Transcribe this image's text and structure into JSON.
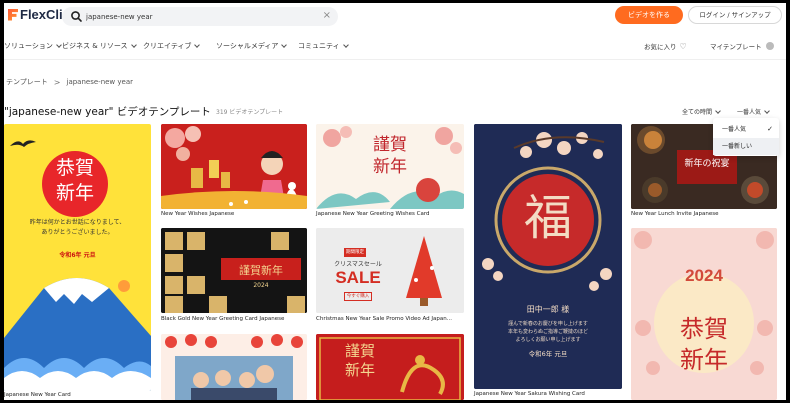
{
  "header": {
    "logo": "FlexClip",
    "search_value": "japanese-new year",
    "clear": "×",
    "create_btn": "ビデオを作る",
    "login_btn": "ログイン / サインアップ"
  },
  "nav": {
    "items": [
      {
        "label": "ソリューション"
      },
      {
        "label": "ビジネス & リソース"
      },
      {
        "label": "クリエイティブ"
      },
      {
        "label": "ソーシャルメディア"
      },
      {
        "label": "コミュニティ"
      }
    ],
    "favorites": "お気に入り",
    "my_templates": "マイテンプレート"
  },
  "breadcrumb": {
    "root": "テンプレート",
    "sep": ">",
    "current": "japanese-new year"
  },
  "title": {
    "text": "\"japanese-new year\" ビデオテンプレート",
    "count": "319 ビデオテンプレート"
  },
  "filters": {
    "time": "全ての時間",
    "sort": "一番人気",
    "options": [
      {
        "label": "一番人気",
        "selected": true
      },
      {
        "label": "一番新しい",
        "selected": false
      }
    ],
    "check": "✓"
  },
  "cards": {
    "c1": {
      "caption": "Japanese New Year Card",
      "kanji": "恭賀\n新年",
      "greeting": "昨年は何かとお世話になりまして、\nありがとうございました。",
      "date": "令和6年 元旦"
    },
    "c2": {
      "caption": "New Year Wishes Japanese"
    },
    "c3": {
      "caption": "Japanese New Year Greeting Wishes Card",
      "kanji": "謹賀\n新年"
    },
    "c4": {
      "caption": "Japanese New Year Sakura Wishing Card",
      "kanji": "福",
      "name": "田中一郎 様",
      "line1": "謹んで新春のお慶びを申し上げます",
      "line2": "本年も変わらぬご指導ご鞭撻のほど",
      "line3": "よろしくお願い申し上げます",
      "date": "令和6年 元旦"
    },
    "c5": {
      "caption": "New Year Lunch Invite Japanese",
      "title": "新年の祝宴"
    },
    "c6": {
      "caption": "Black Gold New Year Greeting Card Japanese",
      "kanji": "謹賀新年",
      "year": "2024"
    },
    "c7": {
      "caption": "Christmas New Year Sale Promo Video Ad Japan...",
      "badge": "期間限定",
      "sub": "クリスマスセール",
      "sale": "SALE",
      "btn": "今すぐ購入"
    },
    "c8": {
      "caption": "",
      "year": "2024",
      "kanji": "恭賀\n新年"
    },
    "c9": {
      "caption": ""
    },
    "c10": {
      "caption": "",
      "kanji": "謹賀\n新年"
    }
  },
  "colors": {
    "accent": "#ff6b1f",
    "c1_bg": "#ffe23a",
    "c4_bg": "#1f2b55"
  }
}
